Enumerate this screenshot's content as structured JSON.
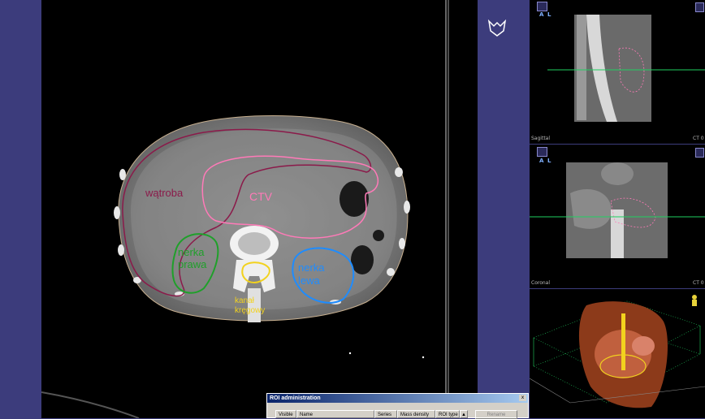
{
  "axial": {
    "rois": [
      {
        "id": "liver",
        "label": "wątroba",
        "color": "#8b1a4a"
      },
      {
        "id": "ctv",
        "label": "CTV",
        "color": "#ff7ab8"
      },
      {
        "id": "right-kidney",
        "label": "nerka\nprawa",
        "color": "#1fa02a"
      },
      {
        "id": "left-kidney",
        "label": "nerka\nlewa",
        "color": "#1e8cff"
      },
      {
        "id": "spinal-canal",
        "label": "kanał\nkręgowy",
        "color": "#f2d21e"
      }
    ]
  },
  "sagittal": {
    "name": "Sagittal",
    "suffix": "CT 0",
    "orient_top": "A",
    "orient_side": "L"
  },
  "coronal": {
    "name": "Coronal",
    "suffix": "CT 0",
    "orient_top": "A",
    "orient_side": "L"
  },
  "roi_admin": {
    "title": "ROI administration",
    "close_label": "x",
    "columns": [
      "Visible",
      "Name",
      "Series",
      "Mass density",
      "ROI type"
    ],
    "sort_indicator": "▲",
    "rename_label": "Rename"
  },
  "colors": {
    "panel_blue": "#3c3c7c",
    "cross_green": "#20d060"
  }
}
